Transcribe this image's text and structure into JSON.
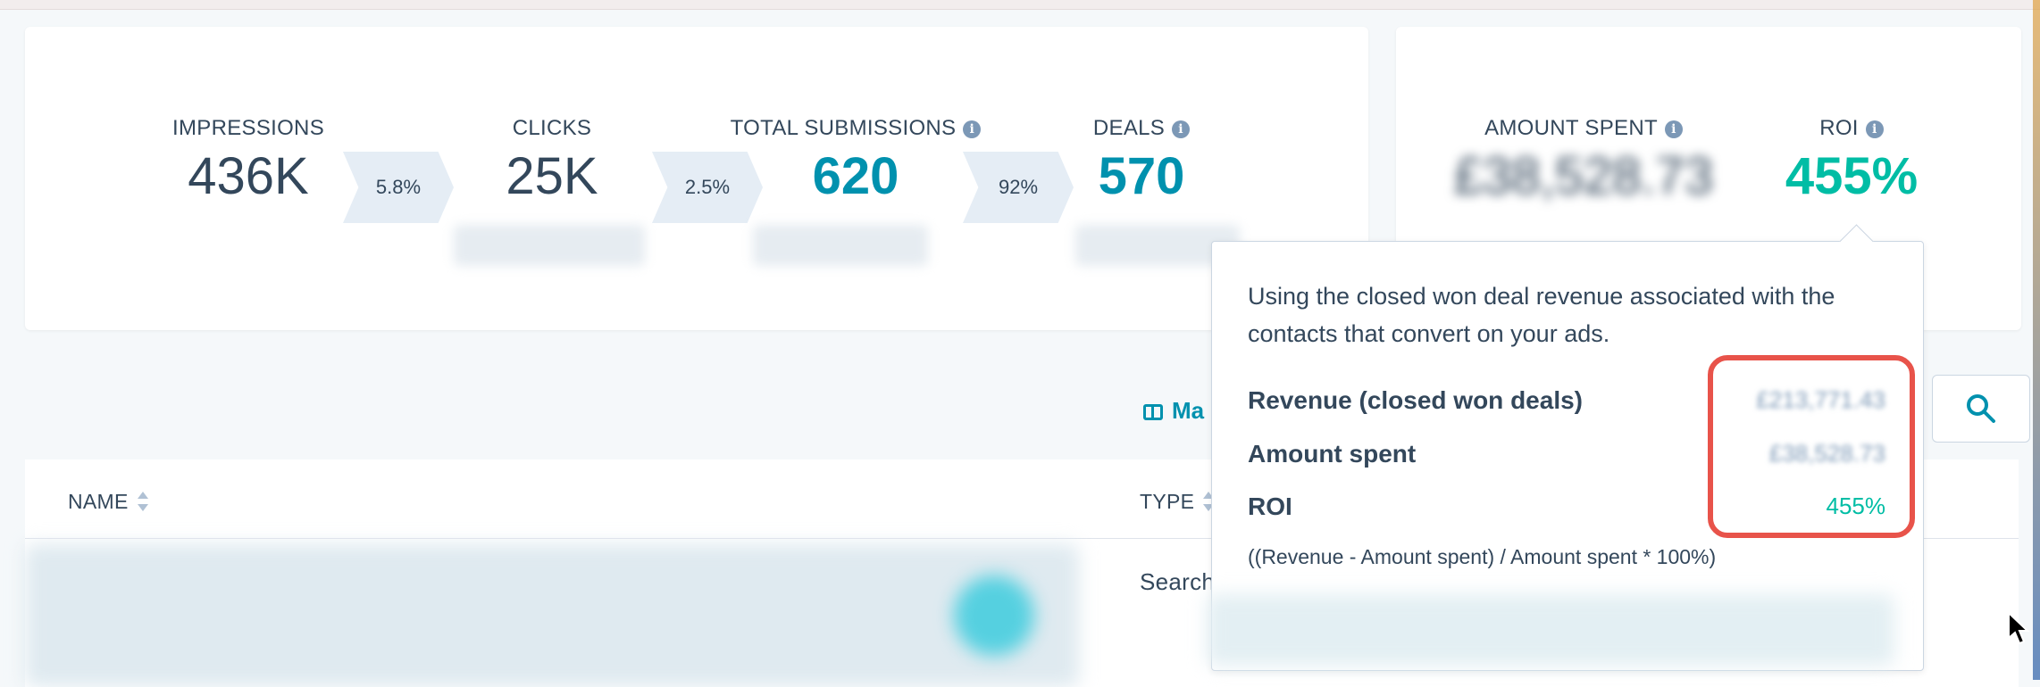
{
  "funnel": {
    "impressions": {
      "label": "IMPRESSIONS",
      "value": "436K"
    },
    "rate1": "5.8%",
    "clicks": {
      "label": "CLICKS",
      "value": "25K"
    },
    "rate2": "2.5%",
    "submissions": {
      "label": "TOTAL SUBMISSIONS",
      "value": "620"
    },
    "rate3": "92%",
    "deals": {
      "label": "DEALS",
      "value": "570"
    }
  },
  "roi_card": {
    "amount_spent_label": "AMOUNT SPENT",
    "amount_spent_value": "£38,528.73",
    "roi_label": "ROI",
    "roi_value": "455%"
  },
  "tooltip": {
    "description": "Using the closed won deal revenue associated with the contacts that convert on your ads.",
    "revenue_label": "Revenue (closed won deals)",
    "revenue_value": "£213,771.43",
    "amount_label": "Amount spent",
    "amount_value": "£38,528.73",
    "roi_label": "ROI",
    "roi_value": "455%",
    "formula": "((Revenue - Amount spent) / Amount spent * 100%)"
  },
  "toolbar": {
    "manage_label": "Ma"
  },
  "table": {
    "col_name": "NAME",
    "col_type": "TYPE",
    "row_type": "Search"
  },
  "colors": {
    "teal": "#0091ae",
    "green": "#00bda5",
    "highlight": "#e8534a"
  }
}
